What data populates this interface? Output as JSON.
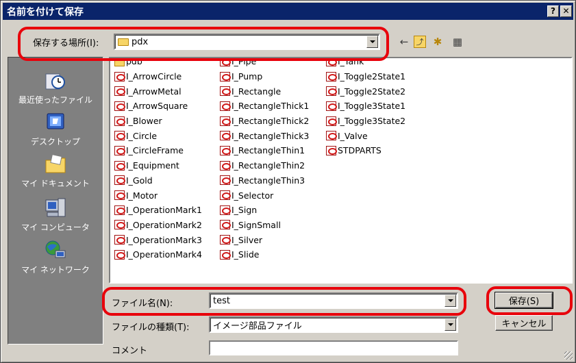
{
  "window": {
    "title": "名前を付けて保存",
    "help_btn": "?",
    "close_btn": "✕"
  },
  "location": {
    "label": "保存する場所(I):",
    "value": "pdx"
  },
  "toolbar": {
    "back_icon": "←",
    "up_icon": "⤴",
    "newfolder_icon": "✱",
    "view_icon": "▦"
  },
  "places": [
    {
      "label": "最近使ったファイル",
      "icon": "recent-icon"
    },
    {
      "label": "デスクトップ",
      "icon": "desktop-icon"
    },
    {
      "label": "マイ ドキュメント",
      "icon": "my-documents-icon"
    },
    {
      "label": "マイ コンピュータ",
      "icon": "my-computer-icon"
    },
    {
      "label": "マイ ネットワーク",
      "icon": "my-network-icon"
    }
  ],
  "files": {
    "col1": [
      {
        "name": "pdb",
        "type": "folder"
      },
      {
        "name": "I_ArrowCircle",
        "type": "part"
      },
      {
        "name": "I_ArrowMetal",
        "type": "part"
      },
      {
        "name": "I_ArrowSquare",
        "type": "part"
      },
      {
        "name": "I_Blower",
        "type": "part"
      },
      {
        "name": "I_Circle",
        "type": "part"
      },
      {
        "name": "I_CircleFrame",
        "type": "part"
      },
      {
        "name": "I_Equipment",
        "type": "part"
      },
      {
        "name": "I_Gold",
        "type": "part"
      },
      {
        "name": "I_Motor",
        "type": "part"
      },
      {
        "name": "I_OperationMark1",
        "type": "part"
      },
      {
        "name": "I_OperationMark2",
        "type": "part"
      },
      {
        "name": "I_OperationMark3",
        "type": "part"
      },
      {
        "name": "I_OperationMark4",
        "type": "part"
      }
    ],
    "col2": [
      {
        "name": "I_Pipe",
        "type": "part"
      },
      {
        "name": "I_Pump",
        "type": "part"
      },
      {
        "name": "I_Rectangle",
        "type": "part"
      },
      {
        "name": "I_RectangleThick1",
        "type": "part"
      },
      {
        "name": "I_RectangleThick2",
        "type": "part"
      },
      {
        "name": "I_RectangleThick3",
        "type": "part"
      },
      {
        "name": "I_RectangleThin1",
        "type": "part"
      },
      {
        "name": "I_RectangleThin2",
        "type": "part"
      },
      {
        "name": "I_RectangleThin3",
        "type": "part"
      },
      {
        "name": "I_Selector",
        "type": "part"
      },
      {
        "name": "I_Sign",
        "type": "part"
      },
      {
        "name": "I_SignSmall",
        "type": "part"
      },
      {
        "name": "I_Silver",
        "type": "part"
      },
      {
        "name": "I_Slide",
        "type": "part"
      }
    ],
    "col3": [
      {
        "name": "I_Tank",
        "type": "part"
      },
      {
        "name": "I_Toggle2State1",
        "type": "part"
      },
      {
        "name": "I_Toggle2State2",
        "type": "part"
      },
      {
        "name": "I_Toggle3State1",
        "type": "part"
      },
      {
        "name": "I_Toggle3State2",
        "type": "part"
      },
      {
        "name": "I_Valve",
        "type": "part"
      },
      {
        "name": "STDPARTS",
        "type": "part"
      }
    ]
  },
  "filename": {
    "label": "ファイル名(N):",
    "value": "test"
  },
  "filetype": {
    "label": "ファイルの種類(T):",
    "value": "イメージ部品ファイル"
  },
  "comment": {
    "label": "コメント",
    "value": ""
  },
  "buttons": {
    "save": "保存(S)",
    "cancel": "キャンセル"
  },
  "colors": {
    "titlebar": "#0a246a",
    "dialog_bg": "#d4d0c8",
    "places_bg": "#808080",
    "annotation": "#e8000b"
  }
}
